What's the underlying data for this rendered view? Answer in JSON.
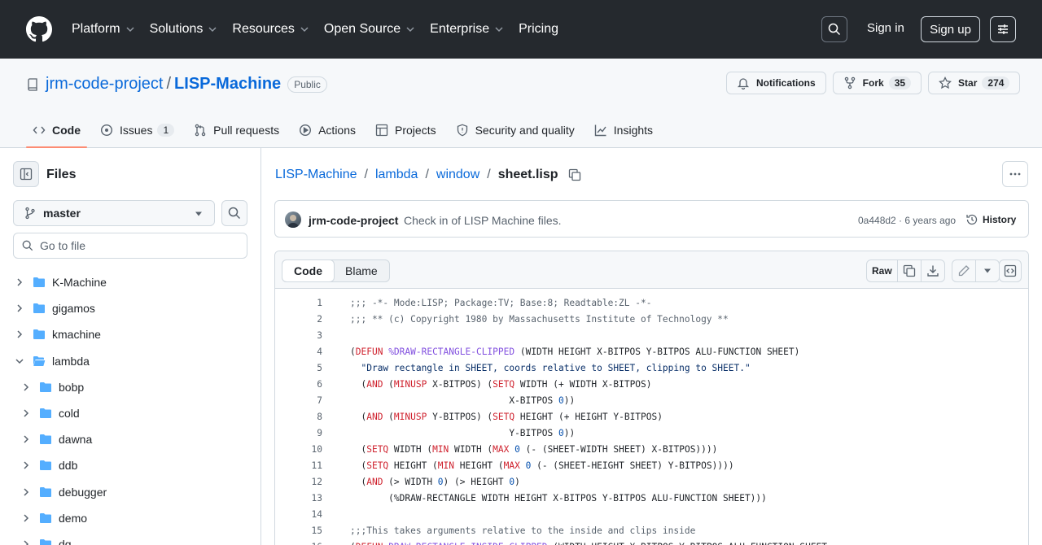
{
  "header": {
    "nav": [
      {
        "label": "Platform",
        "has_menu": true
      },
      {
        "label": "Solutions",
        "has_menu": true
      },
      {
        "label": "Resources",
        "has_menu": true
      },
      {
        "label": "Open Source",
        "has_menu": true
      },
      {
        "label": "Enterprise",
        "has_menu": true
      },
      {
        "label": "Pricing",
        "has_menu": false
      }
    ],
    "sign_in": "Sign in",
    "sign_up": "Sign up"
  },
  "repo": {
    "owner": "jrm-code-project",
    "slash": "/",
    "name": "LISP-Machine",
    "visibility": "Public",
    "notifications_label": "Notifications",
    "fork_label": "Fork",
    "fork_count": "35",
    "star_label": "Star",
    "star_count": "274"
  },
  "tabs": [
    {
      "label": "Code",
      "icon": "code-icon",
      "active": true,
      "count": ""
    },
    {
      "label": "Issues",
      "icon": "issue-icon",
      "active": false,
      "count": "1"
    },
    {
      "label": "Pull requests",
      "icon": "pull-request-icon",
      "active": false,
      "count": ""
    },
    {
      "label": "Actions",
      "icon": "play-icon",
      "active": false,
      "count": ""
    },
    {
      "label": "Projects",
      "icon": "table-icon",
      "active": false,
      "count": ""
    },
    {
      "label": "Security and quality",
      "icon": "shield-icon",
      "active": false,
      "count": ""
    },
    {
      "label": "Insights",
      "icon": "graph-icon",
      "active": false,
      "count": ""
    }
  ],
  "sidebar": {
    "title": "Files",
    "branch": "master",
    "goto_placeholder": "Go to file",
    "tree": [
      {
        "name": "K-Machine",
        "expanded": false,
        "level": 0
      },
      {
        "name": "gigamos",
        "expanded": false,
        "level": 0
      },
      {
        "name": "kmachine",
        "expanded": false,
        "level": 0
      },
      {
        "name": "lambda",
        "expanded": true,
        "level": 0
      },
      {
        "name": "bobp",
        "expanded": false,
        "level": 1
      },
      {
        "name": "cold",
        "expanded": false,
        "level": 1
      },
      {
        "name": "dawna",
        "expanded": false,
        "level": 1
      },
      {
        "name": "ddb",
        "expanded": false,
        "level": 1
      },
      {
        "name": "debugger",
        "expanded": false,
        "level": 1
      },
      {
        "name": "demo",
        "expanded": false,
        "level": 1
      },
      {
        "name": "dg",
        "expanded": false,
        "level": 1
      }
    ]
  },
  "breadcrumb": {
    "parts": [
      "LISP-Machine",
      "lambda",
      "window"
    ],
    "sep": "/",
    "current": "sheet.lisp"
  },
  "commit": {
    "author": "jrm-code-project",
    "message": "Check in of LISP Machine files.",
    "meta": "0a448d2 · 6 years ago",
    "history_label": "History"
  },
  "code_view": {
    "tab_code": "Code",
    "tab_blame": "Blame",
    "raw_label": "Raw",
    "lines": [
      [
        [
          "c",
          ";;; -*- Mode:LISP; Package:TV; Base:8; Readtable:ZL -*-"
        ]
      ],
      [
        [
          "c",
          ";;; ** (c) Copyright 1980 by Massachusetts Institute of Technology **"
        ]
      ],
      [],
      [
        [
          "p",
          "("
        ],
        [
          "kw",
          "DEFUN"
        ],
        [
          "p",
          " "
        ],
        [
          "fn",
          "%DRAW-RECTANGLE-CLIPPED"
        ],
        [
          "p",
          " (WIDTH HEIGHT X-BITPOS Y-BITPOS ALU-FUNCTION SHEET)"
        ]
      ],
      [
        [
          "p",
          "  "
        ],
        [
          "st",
          "\"Draw rectangle in SHEET, coords relative to SHEET, clipping to SHEET.\""
        ]
      ],
      [
        [
          "p",
          "  ("
        ],
        [
          "kw",
          "AND"
        ],
        [
          "p",
          " ("
        ],
        [
          "kw",
          "MINUSP"
        ],
        [
          "p",
          " X-BITPOS) ("
        ],
        [
          "kw",
          "SETQ"
        ],
        [
          "p",
          " WIDTH (+ WIDTH X-BITPOS)"
        ]
      ],
      [
        [
          "p",
          "                             X-BITPOS "
        ],
        [
          "num",
          "0"
        ],
        [
          "p",
          "))"
        ]
      ],
      [
        [
          "p",
          "  ("
        ],
        [
          "kw",
          "AND"
        ],
        [
          "p",
          " ("
        ],
        [
          "kw",
          "MINUSP"
        ],
        [
          "p",
          " Y-BITPOS) ("
        ],
        [
          "kw",
          "SETQ"
        ],
        [
          "p",
          " HEIGHT (+ HEIGHT Y-BITPOS)"
        ]
      ],
      [
        [
          "p",
          "                             Y-BITPOS "
        ],
        [
          "num",
          "0"
        ],
        [
          "p",
          "))"
        ]
      ],
      [
        [
          "p",
          "  ("
        ],
        [
          "kw",
          "SETQ"
        ],
        [
          "p",
          " WIDTH ("
        ],
        [
          "kw",
          "MIN"
        ],
        [
          "p",
          " WIDTH ("
        ],
        [
          "kw",
          "MAX"
        ],
        [
          "p",
          " "
        ],
        [
          "num",
          "0"
        ],
        [
          "p",
          " (- (SHEET-WIDTH SHEET) X-BITPOS))))"
        ]
      ],
      [
        [
          "p",
          "  ("
        ],
        [
          "kw",
          "SETQ"
        ],
        [
          "p",
          " HEIGHT ("
        ],
        [
          "kw",
          "MIN"
        ],
        [
          "p",
          " HEIGHT ("
        ],
        [
          "kw",
          "MAX"
        ],
        [
          "p",
          " "
        ],
        [
          "num",
          "0"
        ],
        [
          "p",
          " (- (SHEET-HEIGHT SHEET) Y-BITPOS))))"
        ]
      ],
      [
        [
          "p",
          "  ("
        ],
        [
          "kw",
          "AND"
        ],
        [
          "p",
          " (> WIDTH "
        ],
        [
          "num",
          "0"
        ],
        [
          "p",
          ") (> HEIGHT "
        ],
        [
          "num",
          "0"
        ],
        [
          "p",
          ")"
        ]
      ],
      [
        [
          "p",
          "       (%DRAW-RECTANGLE WIDTH HEIGHT X-BITPOS Y-BITPOS ALU-FUNCTION SHEET)))"
        ]
      ],
      [],
      [
        [
          "c",
          ";;;This takes arguments relative to the inside and clips inside"
        ]
      ],
      [
        [
          "p",
          "("
        ],
        [
          "kw",
          "DEFUN"
        ],
        [
          "p",
          " "
        ],
        [
          "fn",
          "DRAW-RECTANGLE-INSIDE-CLIPPED"
        ],
        [
          "p",
          " (WIDTH HEIGHT X-BITPOS Y-BITPOS ALU-FUNCTION SHEET"
        ]
      ]
    ]
  },
  "colors": {
    "header_bg": "#25292e",
    "link": "#0969da",
    "active_tab_underline": "#fd8c73",
    "keyword": "#cf222e",
    "function": "#8250df",
    "string": "#0a3069",
    "comment": "#59636e"
  }
}
